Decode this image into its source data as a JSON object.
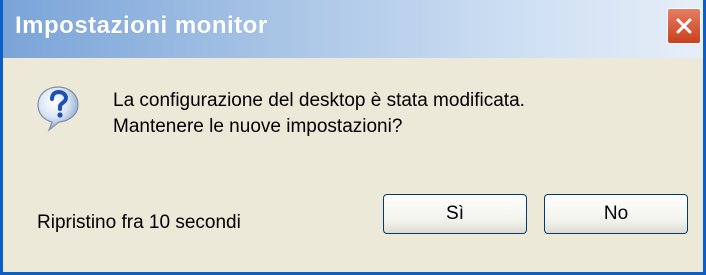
{
  "window": {
    "title": "Impostazioni monitor",
    "close_icon": "close-icon"
  },
  "dialog": {
    "icon": "question-icon",
    "message_line1": "La configurazione del desktop è stata modificata.",
    "message_line2": "Mantenere le nuove impostazioni?",
    "countdown_text": "Ripristino fra 10 secondi"
  },
  "buttons": {
    "yes_label": "Sì",
    "no_label": "No"
  },
  "colors": {
    "title_text": "#ffffff",
    "close_button": "#c9401e",
    "dialog_background": "#ece9d8",
    "button_border": "#003c74"
  }
}
